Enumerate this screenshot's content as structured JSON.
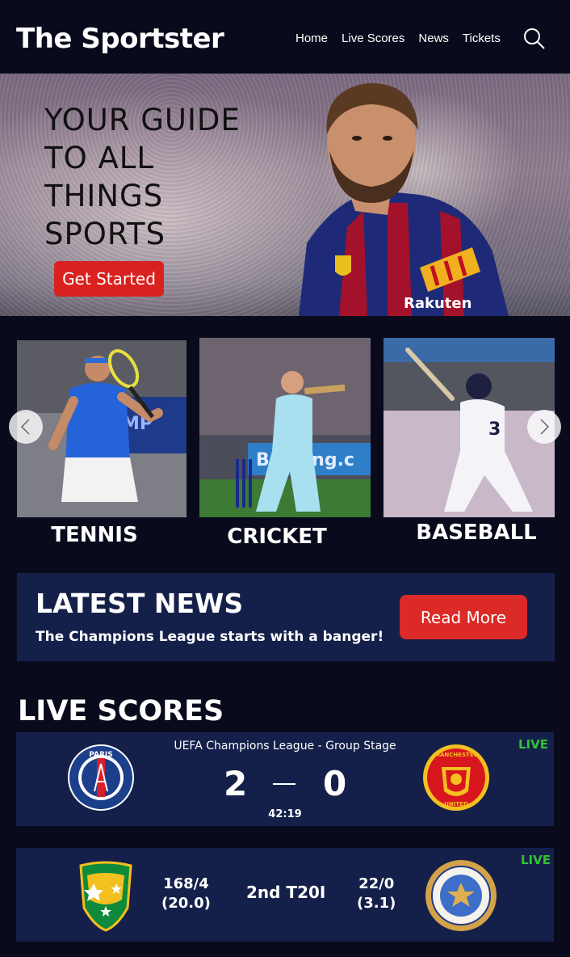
{
  "header": {
    "logo": "The Sportster",
    "nav": [
      "Home",
      "Live Scores",
      "News",
      "Tickets"
    ],
    "search_icon": "search-icon"
  },
  "hero": {
    "line1": "YOUR GUIDE",
    "line2": "TO ALL",
    "line3": "THINGS",
    "line4": "SPORTS",
    "button": "Get Started"
  },
  "sports": [
    {
      "label": "TENNIS"
    },
    {
      "label": "CRICKET"
    },
    {
      "label": "BASEBALL"
    }
  ],
  "news": {
    "title": "LATEST NEWS",
    "headline": "The Champions League starts with a banger!",
    "button": "Read More"
  },
  "live_scores": {
    "heading": "LIVE SCORES",
    "football": {
      "competition": "UEFA Champions League - Group Stage",
      "home_score": "2",
      "away_score": "0",
      "time": "42:19",
      "live": "LIVE"
    },
    "cricket": {
      "team1_score": "168/4",
      "team1_overs": "(20.0)",
      "match": "2nd T20I",
      "team2_score": "22/0",
      "team2_overs": "(3.1)",
      "live": "LIVE"
    }
  },
  "colors": {
    "background": "#090b1c",
    "panel": "#15204a",
    "accent_red": "#dc2a26",
    "live_green": "#2ec52e"
  }
}
